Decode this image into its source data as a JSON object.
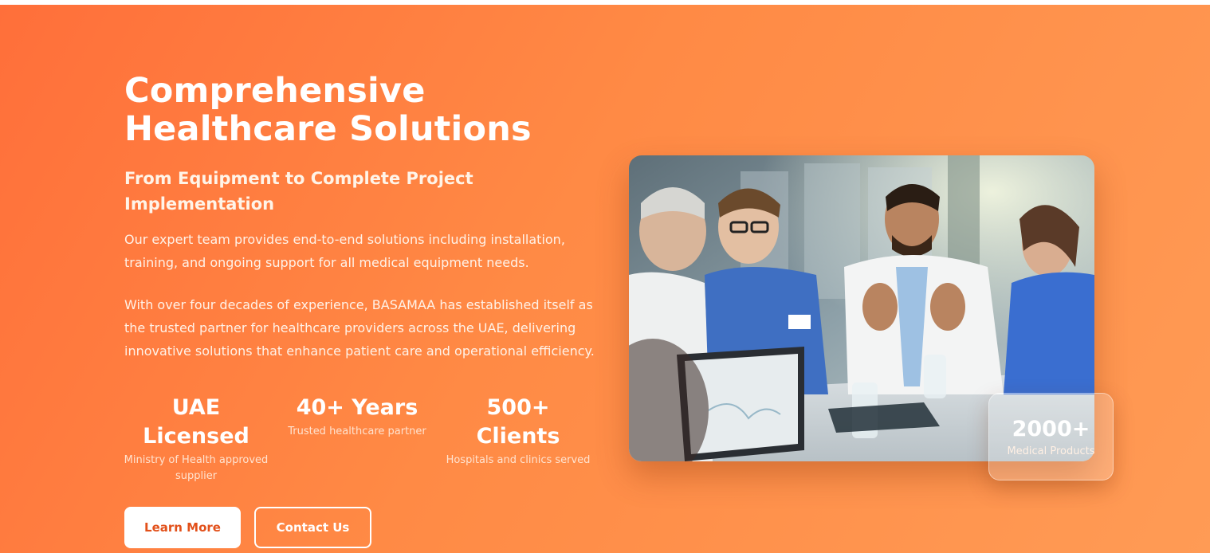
{
  "hero": {
    "title": "Comprehensive Healthcare Solutions",
    "subtitle": "From Equipment to Complete Project Implementation",
    "paragraph_1": "Our expert team provides end-to-end solutions including installation, training, and ongoing support for all medical equipment needs.",
    "paragraph_2": "With over four decades of experience, BASAMAA has established itself as the trusted partner for healthcare providers across the UAE, delivering innovative solutions that enhance patient care and operational efficiency."
  },
  "stats": [
    {
      "value": "UAE Licensed",
      "label": "Ministry of Health approved supplier"
    },
    {
      "value": "40+ Years",
      "label": "Trusted healthcare partner"
    },
    {
      "value": "500+ Clients",
      "label": "Hospitals and clinics served"
    }
  ],
  "buttons": {
    "learn_more": "Learn More",
    "contact_us": "Contact Us"
  },
  "badge": {
    "value": "2000+",
    "label": "Medical Products"
  },
  "colors": {
    "gradient_start": "#ff6f3a",
    "gradient_end": "#ff9b55",
    "button_text": "#e2501a"
  }
}
